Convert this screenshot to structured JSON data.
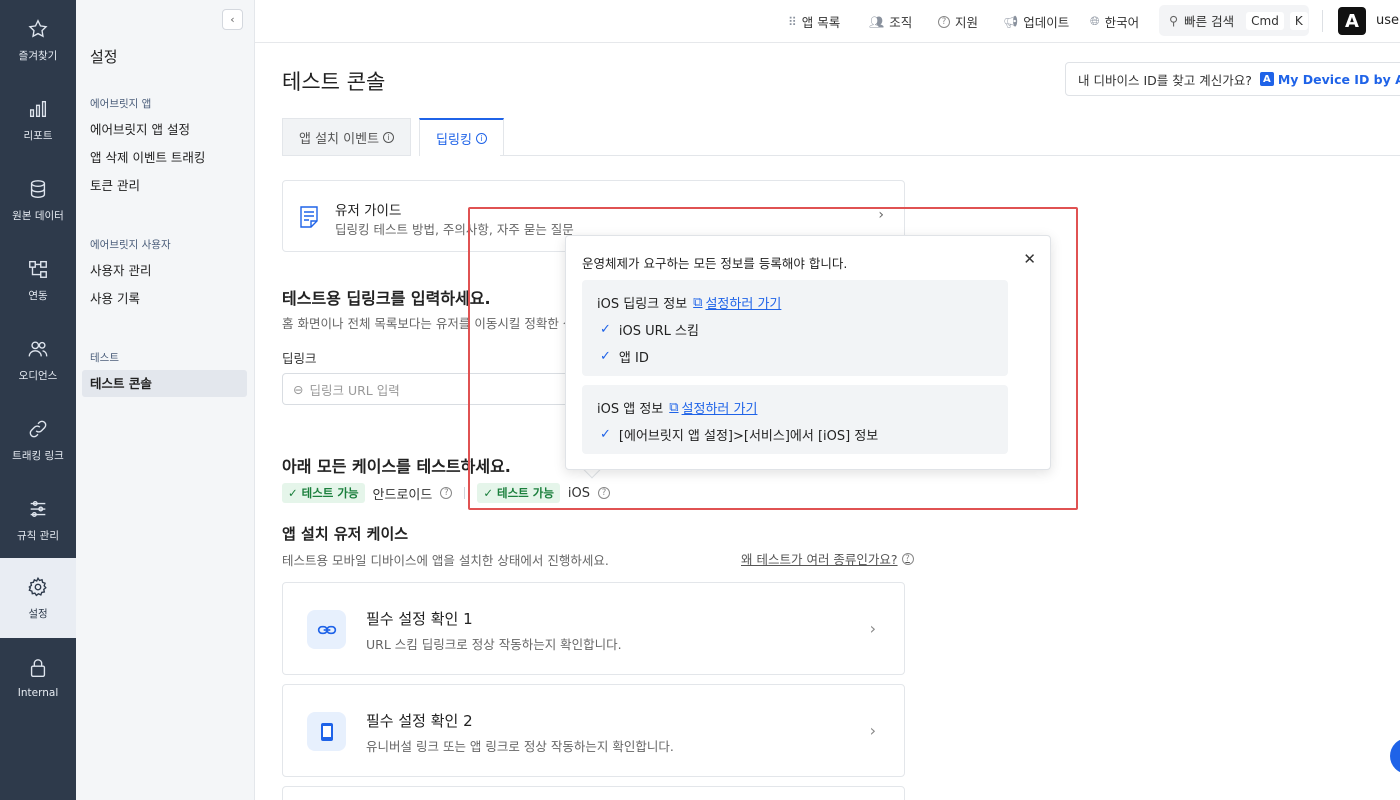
{
  "rail": [
    {
      "label": "즐겨찾기",
      "icon": "star-icon"
    },
    {
      "label": "리포트",
      "icon": "bar-chart-icon"
    },
    {
      "label": "원본 데이터",
      "icon": "database-icon"
    },
    {
      "label": "연동",
      "icon": "integration-icon"
    },
    {
      "label": "오디언스",
      "icon": "audience-icon"
    },
    {
      "label": "트래킹 링크",
      "icon": "link-icon"
    },
    {
      "label": "규칙 관리",
      "icon": "sliders-icon"
    },
    {
      "label": "설정",
      "icon": "gear-icon"
    },
    {
      "label": "Internal",
      "icon": "lock-icon"
    }
  ],
  "sidebar": {
    "title": "설정",
    "groups": [
      {
        "heading": "에어브릿지 앱",
        "items": [
          "에어브릿지 앱 설정",
          "앱 삭제 이벤트 트래킹",
          "토큰 관리"
        ]
      },
      {
        "heading": "에어브릿지 사용자",
        "items": [
          "사용자 관리",
          "사용 기록"
        ]
      },
      {
        "heading": "테스트",
        "items": [
          "테스트 콘솔"
        ]
      }
    ]
  },
  "topbar": {
    "app_list": "앱 목록",
    "org": "조직",
    "support": "지원",
    "updates": "업데이트",
    "language": "한국어",
    "search": "빠른 검색",
    "kbd_cmd": "Cmd",
    "kbd_k": "K",
    "logo": "A",
    "user": "user"
  },
  "main": {
    "title": "테스트 콘솔",
    "device_prompt": "내 디바이스 ID를 찾고 계신가요?",
    "device_badge": "A",
    "device_link": "My Device ID by Airbridge",
    "tabs": [
      "앱 설치 이벤트",
      "딥링킹"
    ],
    "guide_title": "유저 가이드",
    "guide_desc": "딥링킹 테스트 방법, 주의사항, 자주 묻는 질문",
    "input_heading": "테스트용 딥링크를 입력하세요.",
    "input_desc": "홈 화면이나 전체 목록보다는 유저를 이동시킬 정확한 상세",
    "field_label": "딥링크",
    "field_placeholder": "딥링크 URL 입력",
    "cases_heading": "아래 모든 케이스를 테스트하세요.",
    "status": [
      {
        "pill": "✓ 테스트 가능",
        "platform": "안드로이드"
      },
      {
        "pill": "✓ 테스트 가능",
        "platform": "iOS"
      }
    ],
    "install_heading": "앱 설치 유저 케이스",
    "install_desc": "테스트용 모바일 디바이스에 앱을 설치한 상태에서 진행하세요.",
    "why_link": "왜 테스트가 여러 종류인가요?",
    "cards": [
      {
        "title": "필수 설정 확인 1",
        "desc": "URL 스킴 딥링크로 정상 작동하는지 확인합니다.",
        "icon": "link-icon"
      },
      {
        "title": "필수 설정 확인 2",
        "desc": "유니버설 링크 또는 앱 링크로 정상 작동하는지 확인합니다.",
        "icon": "phone-icon"
      }
    ]
  },
  "popover": {
    "title": "운영체제가 요구하는 모든 정보를 등록해야 합니다.",
    "blocks": [
      {
        "title": "iOS 딥링크 정보",
        "link": "설정하러 가기",
        "checks": [
          "iOS URL 스킴",
          "앱 ID"
        ]
      },
      {
        "title": "iOS 앱 정보",
        "link": "설정하러 가기",
        "checks": [
          "[에어브릿지 앱 설정]>[서비스]에서 [iOS] 정보"
        ]
      }
    ]
  },
  "colors": {
    "accent": "#1f63e8",
    "rail_bg": "#2e3a4b",
    "highlight": "#e05252",
    "success": "#1a7f3c"
  }
}
